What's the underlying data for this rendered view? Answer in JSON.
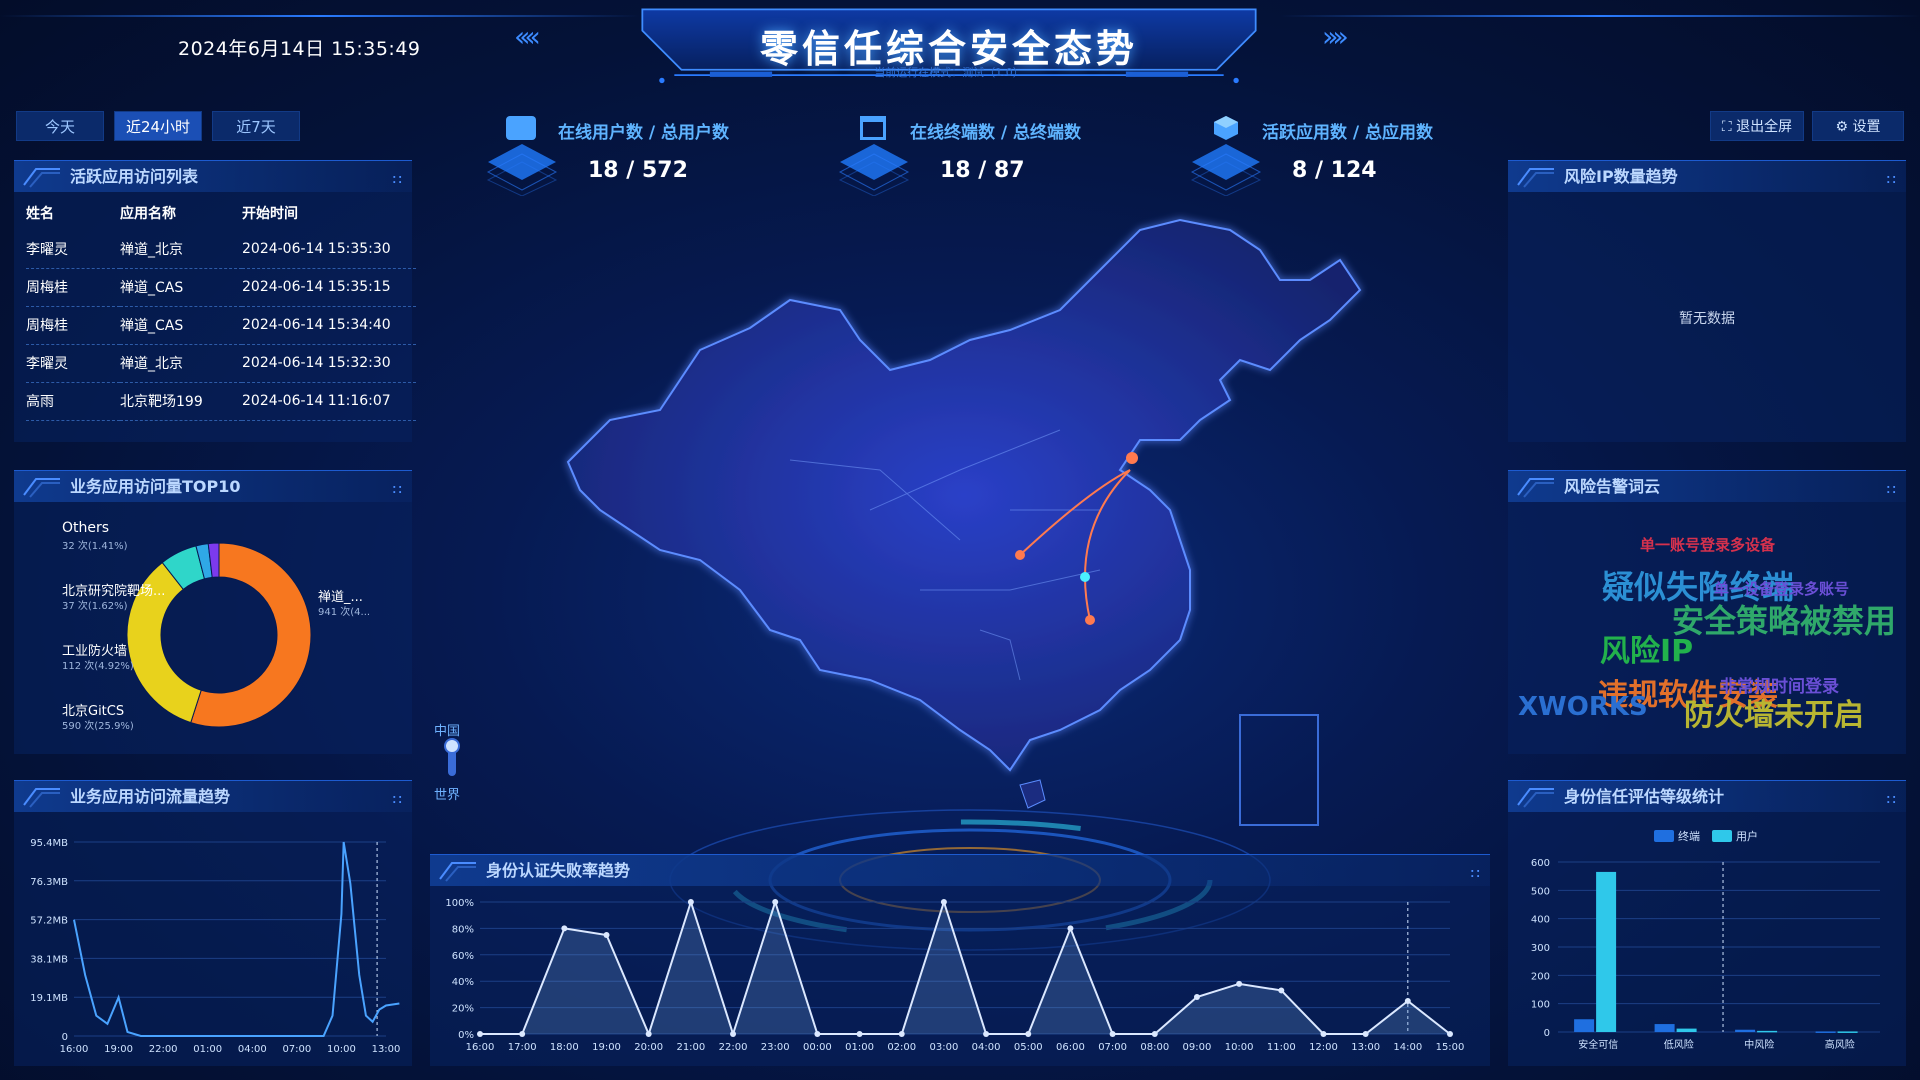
{
  "header": {
    "datetime": "2024年6月14日 15:35:49",
    "title": "零信任综合安全态势",
    "subtitle": "当前运行在模式：测试（1.0）"
  },
  "time_range": {
    "today": "今天",
    "last24h": "近24小时",
    "last7d": "近7天",
    "active": "last24h"
  },
  "toolbar": {
    "exit_fullscreen": "退出全屏",
    "settings": "设置"
  },
  "stats": [
    {
      "label": "在线用户数 / 总用户数",
      "value": "18 / 572",
      "icon": "user-card-icon"
    },
    {
      "label": "在线终端数 / 总终端数",
      "value": "18 / 87",
      "icon": "terminal-icon"
    },
    {
      "label": "活跃应用数 / 总应用数",
      "value": "8 / 124",
      "icon": "cube-icon"
    }
  ],
  "access_list": {
    "title": "活跃应用访问列表",
    "columns": [
      "姓名",
      "应用名称",
      "开始时间"
    ],
    "rows": [
      [
        "李曜灵",
        "禅道_北京",
        "2024-06-14 15:35:30"
      ],
      [
        "周梅桂",
        "禅道_CAS",
        "2024-06-14 15:35:15"
      ],
      [
        "周梅桂",
        "禅道_CAS",
        "2024-06-14 15:34:40"
      ],
      [
        "李曜灵",
        "禅道_北京",
        "2024-06-14 15:32:30"
      ],
      [
        "高雨",
        "北京靶场199",
        "2024-06-14 11:16:07"
      ]
    ]
  },
  "top10": {
    "title": "业务应用访问量TOP10",
    "labels": [
      {
        "name": "Others",
        "detail": "32 次(1.41%)"
      },
      {
        "name": "北京研究院靶场...",
        "detail": "37 次(1.62%)"
      },
      {
        "name": "工业防火墙",
        "detail": "112 次(4.92%)"
      },
      {
        "name": "北京GitCS",
        "detail": "590 次(25.9%)"
      },
      {
        "name": "禅道_...",
        "detail": "941 次(4..."
      }
    ]
  },
  "traffic": {
    "title": "业务应用访问流量趋势"
  },
  "map": {
    "level_cn": "中国",
    "level_world": "世界"
  },
  "auth_fail": {
    "title": "身份认证失败率趋势"
  },
  "risk_ip": {
    "title": "风险IP数量趋势",
    "empty": "暂无数据"
  },
  "wordcloud": {
    "title": "风险告警词云",
    "words": [
      {
        "text": "单一账号登录多设备",
        "color": "#d6314d"
      },
      {
        "text": "疑似失陷终端",
        "color": "#2b8fd4"
      },
      {
        "text": "单一设备登录多账号",
        "color": "#6a4fd6"
      },
      {
        "text": "安全策略被禁用",
        "color": "#2fa86a"
      },
      {
        "text": "风险IP",
        "color": "#22b24c"
      },
      {
        "text": "违规软件安装",
        "color": "#e2702a"
      },
      {
        "text": "非常规时间登录",
        "color": "#6a4fd6"
      },
      {
        "text": "XWORKS",
        "color": "#2a6fd1"
      },
      {
        "text": "防火墙未开启",
        "color": "#b8b532"
      }
    ]
  },
  "trust_level": {
    "title": "身份信任评估等级统计",
    "legend_terminal": "终端",
    "legend_user": "用户"
  },
  "colors": {
    "accent": "#2a7bff",
    "bar_terminal": "#1f6fe0",
    "bar_user": "#2fc8ea",
    "map_route": "#ff7a4f"
  },
  "chart_data": [
    {
      "type": "pie",
      "name": "top10",
      "categories": [
        "禅道_北京",
        "北京GitCS",
        "工业防火墙",
        "北京研究院靶场",
        "Others"
      ],
      "values": [
        941,
        590,
        112,
        37,
        32
      ]
    },
    {
      "type": "line",
      "name": "traffic",
      "x": [
        "16:00",
        "19:00",
        "22:00",
        "01:00",
        "04:00",
        "07:00",
        "10:00",
        "13:00"
      ],
      "y_ticks": [
        "0",
        "19.1MB",
        "38.1MB",
        "57.2MB",
        "76.3MB",
        "95.4MB"
      ],
      "ylim": [
        0,
        95.4
      ],
      "points": [
        [
          0,
          57.2
        ],
        [
          0.25,
          30
        ],
        [
          0.5,
          10
        ],
        [
          0.75,
          6
        ],
        [
          1.0,
          19
        ],
        [
          1.2,
          2
        ],
        [
          1.5,
          0
        ],
        [
          2,
          0
        ],
        [
          3,
          0
        ],
        [
          4,
          0
        ],
        [
          5,
          0
        ],
        [
          5.6,
          0
        ],
        [
          5.8,
          10
        ],
        [
          6.0,
          60
        ],
        [
          6.05,
          95.4
        ],
        [
          6.2,
          75
        ],
        [
          6.4,
          30
        ],
        [
          6.55,
          10
        ],
        [
          6.7,
          7
        ],
        [
          6.85,
          13
        ],
        [
          7.0,
          15
        ],
        [
          7.3,
          16
        ]
      ]
    },
    {
      "type": "line",
      "name": "auth_fail",
      "x": [
        "16:00",
        "17:00",
        "18:00",
        "19:00",
        "20:00",
        "21:00",
        "22:00",
        "23:00",
        "00:00",
        "01:00",
        "02:00",
        "03:00",
        "04:00",
        "05:00",
        "06:00",
        "07:00",
        "08:00",
        "09:00",
        "10:00",
        "11:00",
        "12:00",
        "13:00",
        "14:00",
        "15:00"
      ],
      "y_ticks": [
        "0%",
        "20%",
        "40%",
        "60%",
        "80%",
        "100%"
      ],
      "ylim": [
        0,
        100
      ],
      "values": [
        0,
        0,
        80,
        75,
        0,
        100,
        0,
        100,
        0,
        0,
        0,
        100,
        0,
        0,
        80,
        0,
        0,
        28,
        38,
        33,
        0,
        0,
        25,
        0
      ]
    },
    {
      "type": "bar",
      "name": "trust_level",
      "categories": [
        "安全可信",
        "低风险",
        "中风险",
        "高风险"
      ],
      "y_ticks": [
        "0",
        "100",
        "200",
        "300",
        "400",
        "500",
        "600"
      ],
      "ylim": [
        0,
        600
      ],
      "series": [
        {
          "name": "终端",
          "values": [
            45,
            28,
            8,
            2
          ]
        },
        {
          "name": "用户",
          "values": [
            565,
            12,
            4,
            2
          ]
        }
      ]
    }
  ]
}
